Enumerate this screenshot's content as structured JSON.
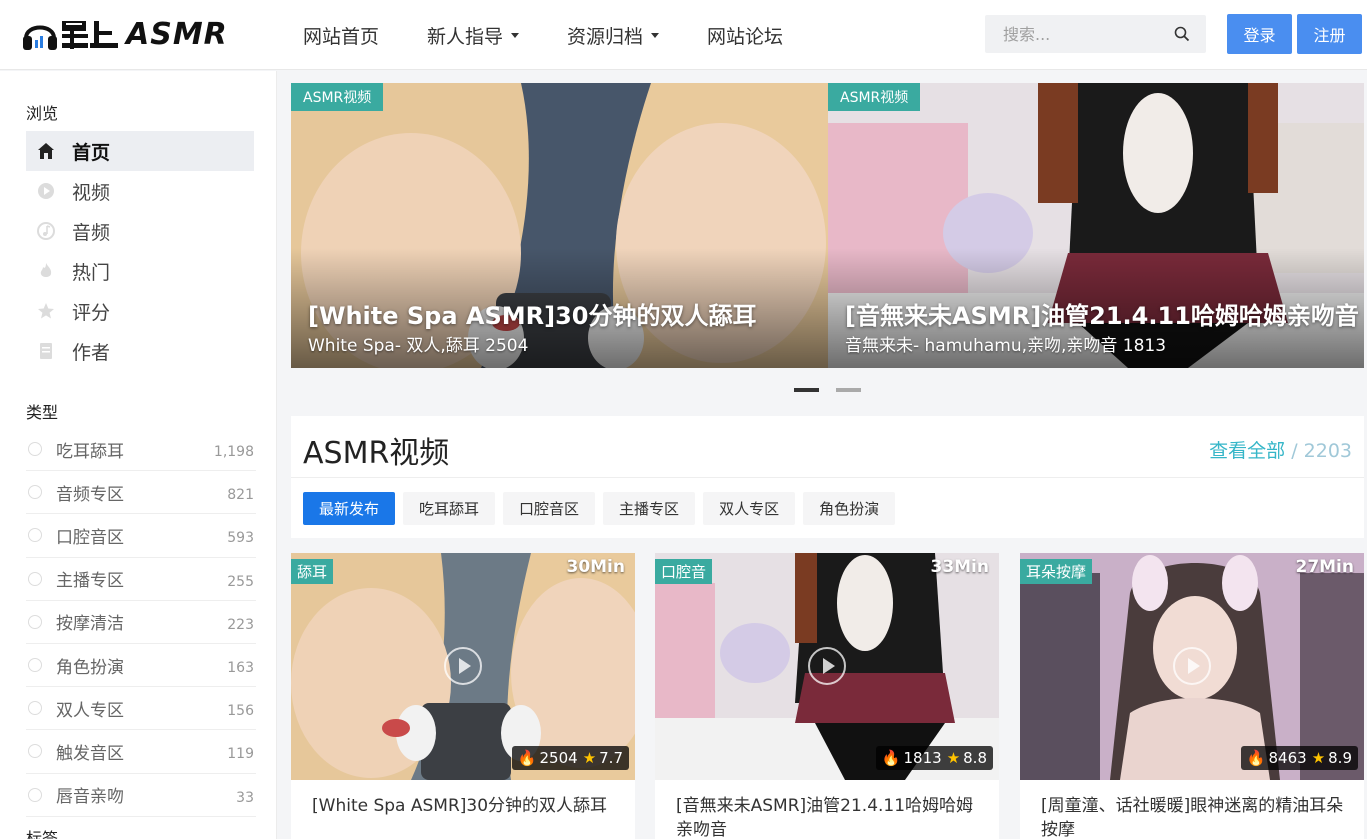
{
  "brand": {
    "logo_text": "ASMR"
  },
  "nav": {
    "items": [
      {
        "label": "网站首页",
        "dropdown": false
      },
      {
        "label": "新人指导",
        "dropdown": true
      },
      {
        "label": "资源归档",
        "dropdown": true
      },
      {
        "label": "网站论坛",
        "dropdown": false
      }
    ]
  },
  "search": {
    "placeholder": "搜索..."
  },
  "auth": {
    "login_label": "登录",
    "register_label": "注册"
  },
  "sidebar": {
    "browse_title": "浏览",
    "browse": [
      {
        "label": "首页",
        "icon": "home-icon",
        "active": true
      },
      {
        "label": "视频",
        "icon": "video-icon",
        "active": false
      },
      {
        "label": "音频",
        "icon": "audio-icon",
        "active": false
      },
      {
        "label": "热门",
        "icon": "fire-icon",
        "active": false
      },
      {
        "label": "评分",
        "icon": "star-icon",
        "active": false
      },
      {
        "label": "作者",
        "icon": "author-icon",
        "active": false
      }
    ],
    "types_title": "类型",
    "types": [
      {
        "label": "吃耳舔耳",
        "count": "1,198"
      },
      {
        "label": "音频专区",
        "count": "821"
      },
      {
        "label": "口腔音区",
        "count": "593"
      },
      {
        "label": "主播专区",
        "count": "255"
      },
      {
        "label": "按摩清洁",
        "count": "223"
      },
      {
        "label": "角色扮演",
        "count": "163"
      },
      {
        "label": "双人专区",
        "count": "156"
      },
      {
        "label": "触发音区",
        "count": "119"
      },
      {
        "label": "唇音亲吻",
        "count": "33"
      }
    ],
    "tags_title": "标签"
  },
  "carousel": {
    "slides": [
      {
        "tag": "ASMR视频",
        "title": "[White Spa ASMR]30分钟的双人舔耳",
        "subtitle": "White Spa- 双人,舔耳 2504"
      },
      {
        "tag": "ASMR视频",
        "title": "[音無来未ASMR]油管21.4.11哈姆哈姆亲吻音",
        "subtitle": "音無来未- hamuhamu,亲吻,亲吻音 1813"
      }
    ],
    "active_index": 0
  },
  "section": {
    "title": "ASMR视频",
    "view_all": "查看全部",
    "separator": "/",
    "total": "2203"
  },
  "filters": [
    "最新发布",
    "吃耳舔耳",
    "口腔音区",
    "主播专区",
    "双人专区",
    "角色扮演"
  ],
  "active_filter": 0,
  "videos": [
    {
      "tag": "舔耳",
      "duration": "30Min",
      "views": "2504",
      "rating": "7.7",
      "title": "[White Spa ASMR]30分钟的双人舔耳"
    },
    {
      "tag": "口腔音",
      "duration": "33Min",
      "views": "1813",
      "rating": "8.8",
      "title": "[音無来未ASMR]油管21.4.11哈姆哈姆亲吻音"
    },
    {
      "tag": "耳朵按摩",
      "duration": "27Min",
      "views": "8463",
      "rating": "8.9",
      "title": "[周童潼、话社暖暖]眼神迷离的精油耳朵按摩"
    }
  ],
  "colors": {
    "accent": "#4a8ef0",
    "tag_bg": "#3aaaa0",
    "link": "#35b6c8",
    "filter_active": "#1a77e8"
  }
}
